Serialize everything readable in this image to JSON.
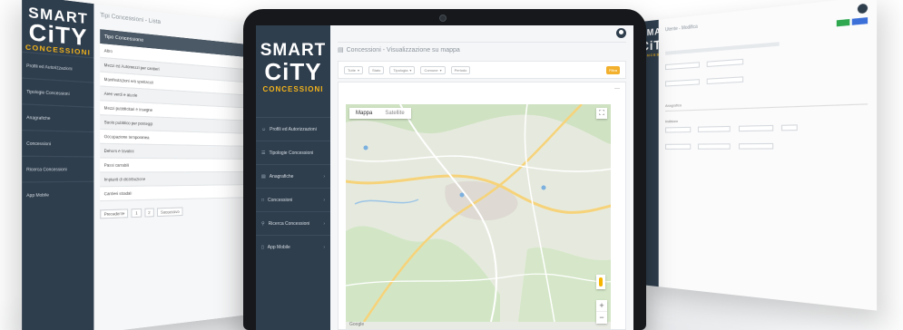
{
  "brand": {
    "line1": "SMART",
    "line2": "CiTY",
    "line3": "CONCESSIONI"
  },
  "brand_colors": {
    "sidebar": "#2f3e4d",
    "accent": "#f3b31a",
    "button_orange": "#f2b02c"
  },
  "main_screen": {
    "page_title": "Concessioni - Visualizzazione su mappa",
    "sidebar_items": [
      {
        "label": "Profili ed Autorizzazioni",
        "icon": "users-icon"
      },
      {
        "label": "Tipologie Concessioni",
        "icon": "list-icon"
      },
      {
        "label": "Anagrafiche",
        "icon": "id-card-icon"
      },
      {
        "label": "Concessioni",
        "icon": "file-icon"
      },
      {
        "label": "Ricerca Concessioni",
        "icon": "search-icon"
      },
      {
        "label": "App Mobile",
        "icon": "mobile-icon"
      }
    ],
    "filters": [
      "Tutte",
      "Stato",
      "Tipologia",
      "Comune",
      "Periodo"
    ],
    "filter_button": "Filtra",
    "map": {
      "tabs": [
        "Mappa",
        "Satellite"
      ],
      "attribution": "Google"
    }
  },
  "left_screen": {
    "page_title": "Tipi Concessioni - Lista",
    "table_header": "Tipo Concessione",
    "rows": [
      "Altro",
      "Mezzi ed Automezzi per cantieri",
      "Manifestazioni e/o spettacoli",
      "Aree verdi e aiuole",
      "Mezzi pubblicitari e insegne",
      "Suolo pubblico per ponteggi",
      "Occupazione temporanea",
      "Dehors e tavolini",
      "Passi carrabili",
      "Impianti di distribuzione",
      "Cantieri stradali"
    ],
    "pager": [
      "Precedente",
      "1",
      "2",
      "Successivo"
    ]
  },
  "right_screen": {
    "page_title": "Utente - Modifica",
    "tab": "Anagrafica",
    "section": "Indirizzo"
  }
}
